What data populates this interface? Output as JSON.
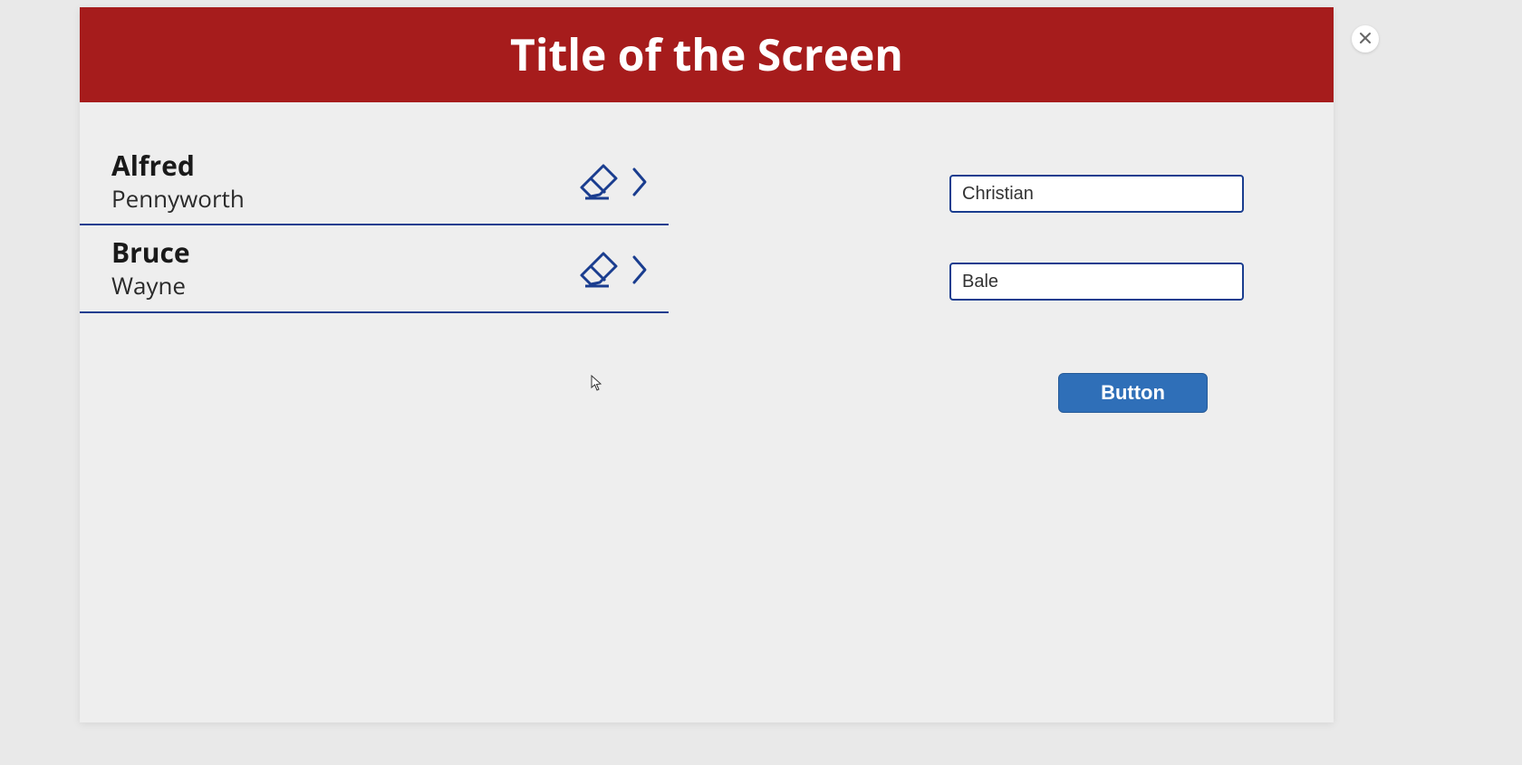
{
  "header": {
    "title": "Title of the Screen"
  },
  "list": {
    "items": [
      {
        "first": "Alfred",
        "last": "Pennyworth"
      },
      {
        "first": "Bruce",
        "last": "Wayne"
      }
    ]
  },
  "form": {
    "input1_value": "Christian",
    "input2_value": "Bale",
    "button_label": "Button"
  },
  "icons": {
    "close": "close-icon",
    "eraser": "eraser-icon",
    "chevron": "chevron-right-icon"
  },
  "colors": {
    "header_bg": "#a61c1c",
    "accent": "#1a3d8f",
    "button_bg": "#2f6fb8"
  }
}
